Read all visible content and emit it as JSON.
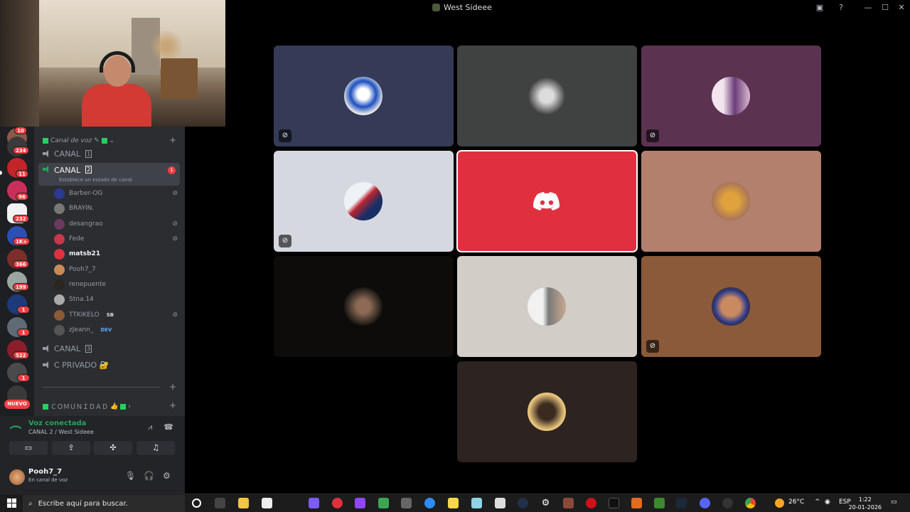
{
  "window": {
    "title": "West Sideee"
  },
  "servers": {
    "badges": [
      "10",
      "234",
      "11",
      "96",
      "232",
      "1K+",
      "366",
      "199",
      "1",
      "1",
      "522",
      "1"
    ],
    "new_label": "NUEVO"
  },
  "sidebar": {
    "category1": "Canal de voz",
    "channels": [
      {
        "name": "CANAL",
        "num": "1"
      },
      {
        "name": "CANAL",
        "num": "2",
        "status": "Establece un estado de canal",
        "badge": "1"
      },
      {
        "name": "CANAL",
        "num": "3"
      },
      {
        "name": "C PRIVADO 🔐"
      }
    ],
    "members": [
      {
        "name": "Barber-OG",
        "muted": true
      },
      {
        "name": "BRAYIN.",
        "muted": false
      },
      {
        "name": "desangrao",
        "muted": true
      },
      {
        "name": "Fede",
        "muted": true
      },
      {
        "name": "matsb21",
        "muted": false
      },
      {
        "name": "Pooh7_7",
        "muted": false
      },
      {
        "name": "renepuente",
        "muted": false
      },
      {
        "name": "Stna.14",
        "muted": false
      },
      {
        "name": "TTKIKELO",
        "tag": "SB",
        "muted": true
      },
      {
        "name": "zJeann_",
        "tag": "DEV",
        "muted": false
      }
    ],
    "category2": "ＣＯＭＵＮＩＤＡＤ"
  },
  "voice": {
    "status": "Voz conectada",
    "location": "CANAL 2 / West Sideee"
  },
  "user": {
    "name": "Pooh7_7",
    "status": "En canal de voz"
  },
  "taskbar": {
    "search_placeholder": "Escribe aquí para buscar.",
    "temperature": "26°C",
    "language": "ESP",
    "time": "1:22",
    "date": "20-01-2026"
  },
  "colors": {
    "accent_red": "#e0303f",
    "online_green": "#23a55a"
  }
}
